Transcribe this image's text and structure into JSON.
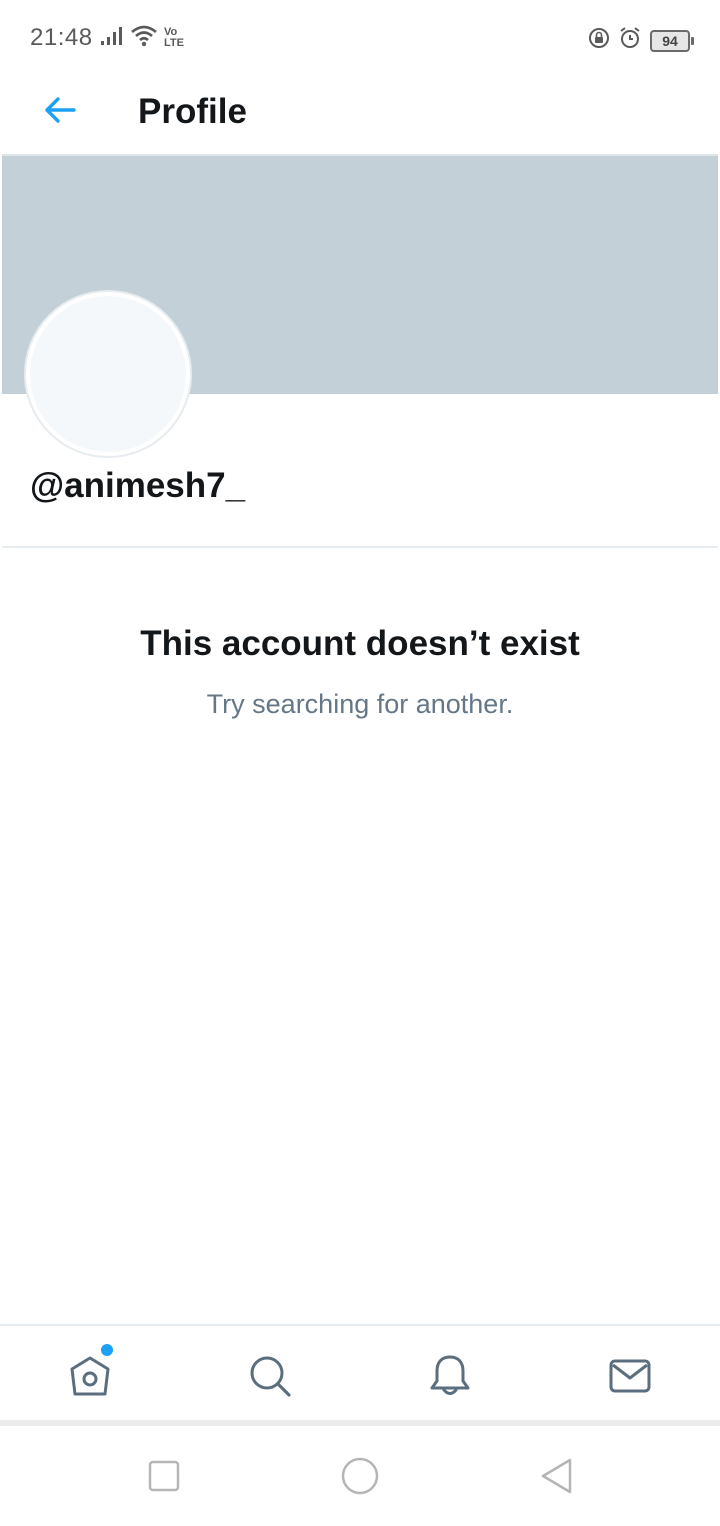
{
  "status_bar": {
    "time": "21:48",
    "network_label": "Vo LTE",
    "battery_level": "94",
    "icons": [
      "signal-icon",
      "wifi-icon",
      "volte-icon",
      "rotation-lock-icon",
      "alarm-icon",
      "battery-icon"
    ]
  },
  "header": {
    "back_icon": "arrow-left-icon",
    "title": "Profile"
  },
  "profile": {
    "banner_color": "#c4d0d7",
    "handle": "@animesh7_"
  },
  "empty_state": {
    "title": "This account doesn’t exist",
    "subtitle": "Try searching for another."
  },
  "bottom_nav": {
    "items": [
      {
        "name": "home",
        "icon": "home-icon",
        "has_notification_dot": true
      },
      {
        "name": "search",
        "icon": "search-icon"
      },
      {
        "name": "notifications",
        "icon": "bell-icon"
      },
      {
        "name": "messages",
        "icon": "mail-icon"
      }
    ],
    "accent_color": "#1da1f2"
  },
  "system_nav": {
    "items": [
      "recents-icon",
      "home-circle-icon",
      "back-triangle-icon"
    ]
  }
}
